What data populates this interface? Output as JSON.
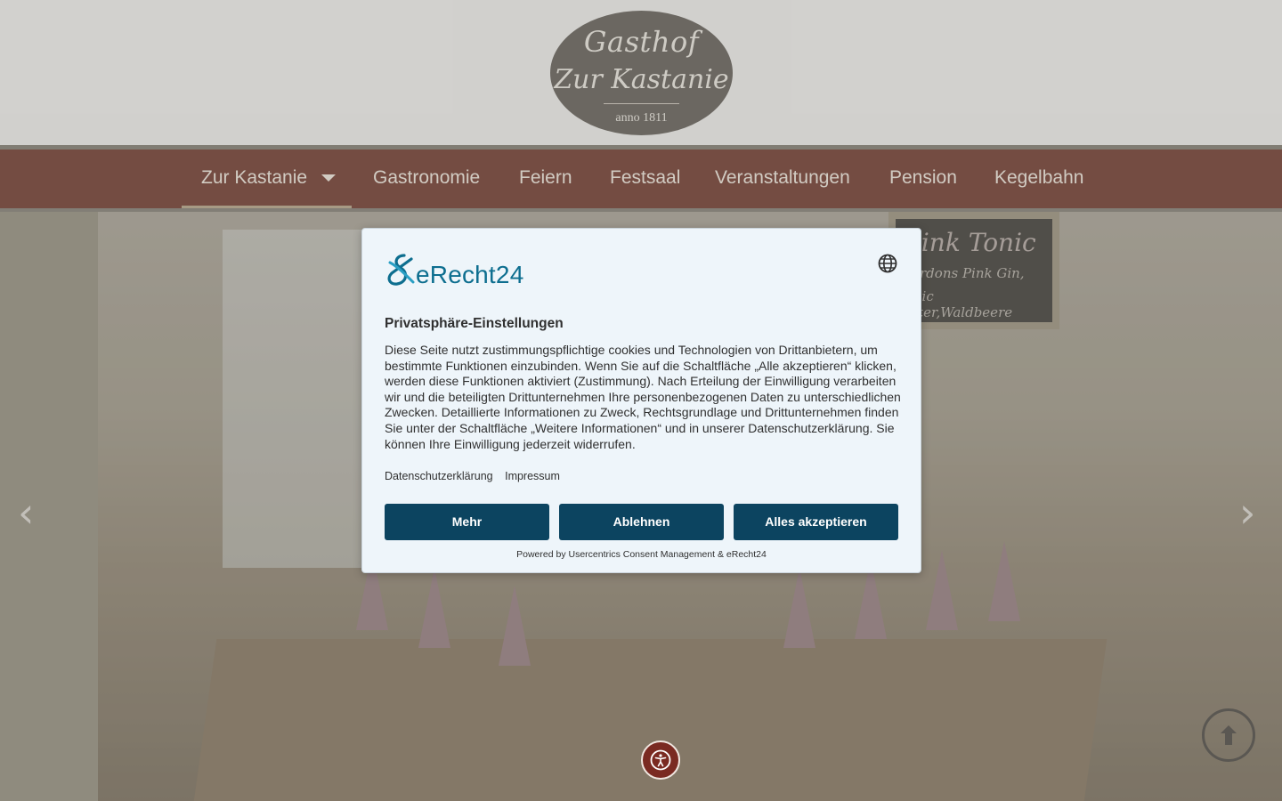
{
  "logo": {
    "line1": "Gasthof",
    "line2": "Zur Kastanie",
    "line3": "anno 1811"
  },
  "nav": {
    "items": [
      {
        "label": "Zur Kastanie",
        "has_dropdown": true,
        "active": true
      },
      {
        "label": "Gastronomie"
      },
      {
        "label": "Feiern"
      },
      {
        "label": "Festsaal"
      },
      {
        "label": "Veranstaltungen"
      },
      {
        "label": "Pension"
      },
      {
        "label": "Kegelbahn"
      }
    ]
  },
  "hero": {
    "board_line1": "Pink Tonic",
    "board_line2": "Gordons Pink Gin,",
    "board_line3": "Tonic Water,Waldbeere",
    "prev_arrow": "‹",
    "next_arrow": "›"
  },
  "consent": {
    "brand": "eRecht24",
    "title": "Privatsphäre-Einstellungen",
    "body": "Diese Seite nutzt zustimmungspflichtige cookies und Technologien von Drittanbietern, um bestimmte Funktionen einzubinden. Wenn Sie auf die Schaltfläche „Alle akzeptieren“ klicken, werden diese Funktionen aktiviert (Zustimmung). Nach Erteilung der Einwilligung verarbeiten wir und die beteiligten Drittunternehmen Ihre personenbezogenen Daten zu unterschiedlichen Zwecken. Detaillierte Informationen zu Zweck, Rechtsgrundlage und Drittunternehmen finden Sie unter der Schaltfläche „Weitere Informationen“ und in unserer Datenschutzerklärung. Sie können Ihre Einwilligung jederzeit widerrufen.",
    "link_privacy": "Datenschutzerklärung",
    "link_imprint": "Impressum",
    "btn_more": "Mehr",
    "btn_deny": "Ablehnen",
    "btn_accept": "Alles akzeptieren",
    "powered": "Powered by Usercentrics Consent Management & eRecht24"
  },
  "colors": {
    "nav_bg": "#7b4a3e",
    "button_bg": "#0c4460",
    "brand_teal": "#0d6e8f",
    "modal_bg": "#eef5fa"
  },
  "icons": {
    "language": "globe-icon",
    "accessibility": "accessibility-icon",
    "scroll_top": "arrow-up-icon"
  }
}
